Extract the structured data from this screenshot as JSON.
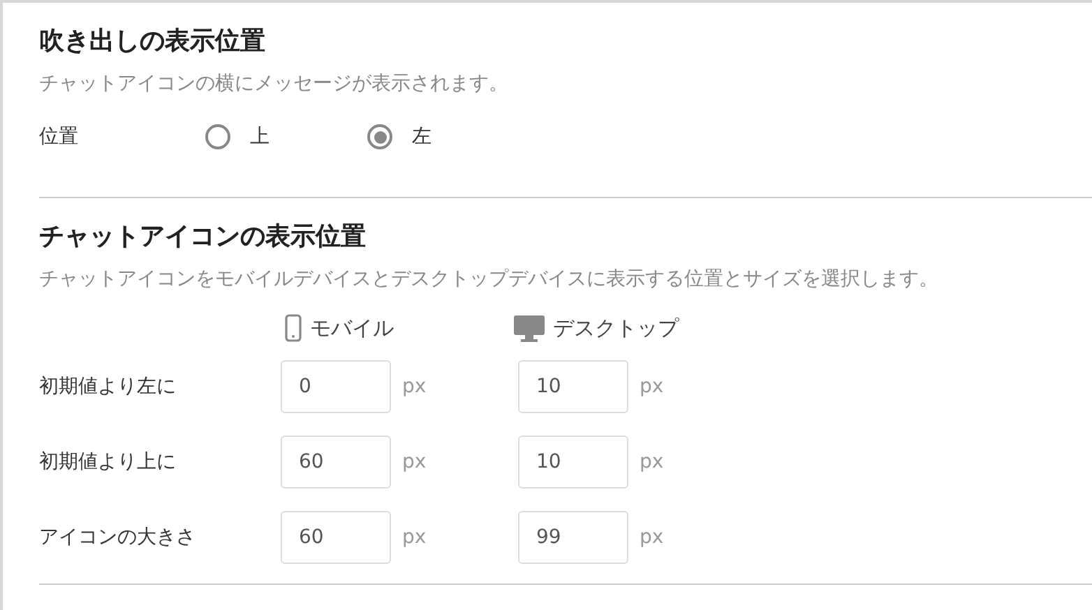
{
  "bubble_position": {
    "title": "吹き出しの表示位置",
    "description": "チャットアイコンの横にメッセージが表示されます。",
    "label": "位置",
    "options": [
      {
        "label": "上",
        "selected": false
      },
      {
        "label": "左",
        "selected": true
      }
    ]
  },
  "icon_position": {
    "title": "チャットアイコンの表示位置",
    "description": "チャットアイコンをモバイルデバイスとデスクトップデバイスに表示する位置とサイズを選択します。",
    "columns": [
      {
        "kind": "mobile",
        "label": "モバイル"
      },
      {
        "kind": "desktop",
        "label": "デスクトップ"
      }
    ],
    "rows": [
      {
        "label": "初期値より左に",
        "values": [
          {
            "value": "0",
            "unit": "px"
          },
          {
            "value": "10",
            "unit": "px"
          }
        ]
      },
      {
        "label": "初期値より上に",
        "values": [
          {
            "value": "60",
            "unit": "px"
          },
          {
            "value": "10",
            "unit": "px"
          }
        ]
      },
      {
        "label": "アイコンの大きさ",
        "values": [
          {
            "value": "60",
            "unit": "px"
          },
          {
            "value": "99",
            "unit": "px"
          }
        ]
      }
    ]
  }
}
